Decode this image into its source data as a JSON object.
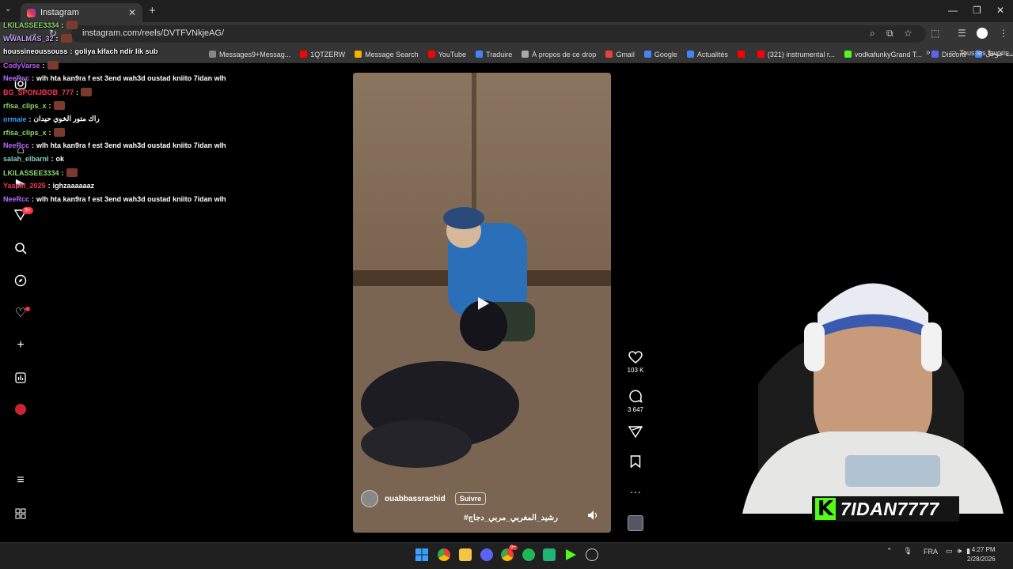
{
  "browser": {
    "tab_title": "Instagram",
    "url": "instagram.com/reels/DVTFVNkjeAG/",
    "bookmarks": [
      {
        "label": "Messages9+Messag...",
        "color": "#888888"
      },
      {
        "label": "1QTZERW",
        "color": "#ff0000"
      },
      {
        "label": "Message Search",
        "color": "#f4b400"
      },
      {
        "label": "YouTube",
        "color": "#ff0000"
      },
      {
        "label": "Traduire",
        "color": "#4285f4"
      },
      {
        "label": "À propos de ce drop",
        "color": "#aaaaaa"
      },
      {
        "label": "Gmail",
        "color": "#ea4335"
      },
      {
        "label": "Google",
        "color": "#4285f4"
      },
      {
        "label": "Actualités",
        "color": "#4285f4"
      },
      {
        "label": "",
        "color": "#ff0000"
      },
      {
        "label": "(321) instrumental r...",
        "color": "#ff0000"
      },
      {
        "label": "vodkafunkyGrand T...",
        "color": "#53fc18"
      },
      {
        "label": "Discord",
        "color": "#5865f2"
      },
      {
        "label": "الفيسبوك - بحث جوجل",
        "color": "#4285f4"
      }
    ],
    "favorites_label": "Tous les favoris"
  },
  "chat": [
    {
      "user": "LKILASSEE3334",
      "color": "#8bd96a",
      "msg": "",
      "emote": true
    },
    {
      "user": "WWALMAS_32",
      "color": "#c8a0ff",
      "msg": "",
      "emote": true
    },
    {
      "user": "houssineoussouss",
      "color": "#ffffff",
      "msg": "goliya kifach ndir lik sub",
      "emote": false
    },
    {
      "user": "CodyVarse",
      "color": "#c05cff",
      "msg": "",
      "emote": true
    },
    {
      "user": "NeeRcc",
      "color": "#b36cff",
      "msg": "wlh hta kan9ra f est 3end wah3d oustad kniito 7idan wlh",
      "emote": false
    },
    {
      "user": "BG_SPONJBOB_777",
      "color": "#ff3355",
      "msg": "",
      "emote": true
    },
    {
      "user": "rfisa_clips_x",
      "color": "#8bd96a",
      "msg": "",
      "emote": true
    },
    {
      "user": "ormaie",
      "color": "#3aa0ff",
      "msg": "راك متور الخوي حيدان",
      "emote": false
    },
    {
      "user": "rfisa_clips_x",
      "color": "#8bd96a",
      "msg": "",
      "emote": true
    },
    {
      "user": "NeeRcc",
      "color": "#b36cff",
      "msg": "wlh hta kan9ra f est 3end wah3d oustad kniito 7idan wlh",
      "emote": false
    },
    {
      "user": "salah_elbarnI",
      "color": "#7fd0c0",
      "msg": "ok",
      "emote": false
    },
    {
      "user": "LKILASSEE3334",
      "color": "#8bd96a",
      "msg": "",
      "emote": true
    },
    {
      "user": "Yassin_2025",
      "color": "#ff3355",
      "msg": "ighzaaaaaaz",
      "emote": false
    },
    {
      "user": "NeeRcc",
      "color": "#b36cff",
      "msg": "wlh hta kan9ra f est 3end wah3d oustad kniito 7idan wlh",
      "emote": false
    }
  ],
  "nav": {
    "notif_badge": "9+"
  },
  "reel": {
    "username": "ouabbassrachid",
    "follow_label": "Suivre",
    "caption": "#رشيد_المغربي_مربي_دجاج",
    "likes": "103 K",
    "comments": "3 647"
  },
  "stream": {
    "channel_name": "7IDAN7777",
    "platform_letter": "K"
  },
  "taskbar": {
    "language": "FRA",
    "time": "4:27 PM",
    "date": "2/28/2026",
    "chrome_badge": "9+"
  }
}
